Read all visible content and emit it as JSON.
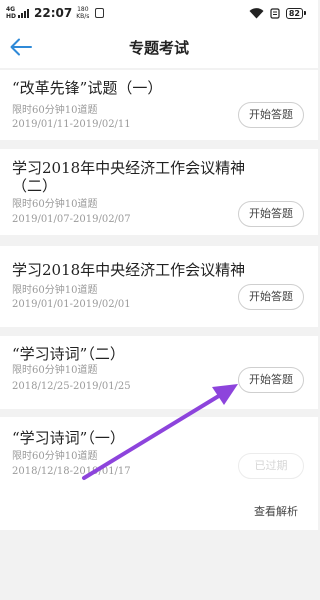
{
  "status_bar": {
    "network": "4G",
    "network_sub": "HD",
    "time": "22:07",
    "speed_value": "180",
    "speed_unit": "KB/s",
    "battery": "82"
  },
  "header": {
    "title": "专题考试",
    "back_icon": "arrow-left-icon"
  },
  "exams": [
    {
      "title": "“改革先锋”试题（一）",
      "limit": "限时60分钟10道题",
      "dates": "2019/01/11-2019/02/11",
      "button": "开始答题"
    },
    {
      "title": "学习2018年中央经济工作会议精神（二）",
      "limit": "限时60分钟10道题",
      "dates": "2019/01/07-2019/02/07",
      "button": "开始答题"
    },
    {
      "title": "学习2018年中央经济工作会议精神",
      "limit": "限时60分钟10道题",
      "dates": "2019/01/01-2019/02/01",
      "button": "开始答题"
    },
    {
      "title": "“学习诗词”（二）",
      "limit": "限时60分钟10道题",
      "dates": "2018/12/25-2019/01/25",
      "button": "开始答题"
    },
    {
      "title": "“学习诗词”（一）",
      "limit": "限时60分钟10道题",
      "dates": "2018/12/18-2019/01/17",
      "button": "已过期",
      "review": "查看解析"
    }
  ],
  "colors": {
    "accent": "#2f8ad8",
    "annotation_arrow": "#8d44dc",
    "background": "#f2f2f2"
  }
}
